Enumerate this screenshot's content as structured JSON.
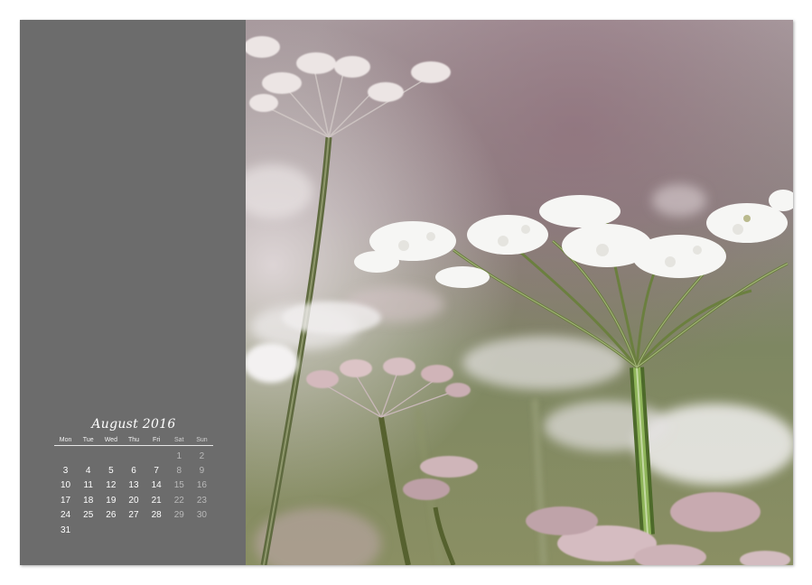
{
  "calendar": {
    "month_title": "August 2016",
    "weekdays": [
      "Mon",
      "Tue",
      "Wed",
      "Thu",
      "Fri",
      "Sat",
      "Sun"
    ],
    "weeks": [
      [
        "",
        "",
        "",
        "",
        "",
        "1",
        "2"
      ],
      [
        "3",
        "4",
        "5",
        "6",
        "7",
        "8",
        "9"
      ],
      [
        "10",
        "11",
        "12",
        "13",
        "14",
        "15",
        "16"
      ],
      [
        "17",
        "18",
        "19",
        "20",
        "21",
        "22",
        "23"
      ],
      [
        "24",
        "25",
        "26",
        "27",
        "28",
        "29",
        "30"
      ],
      [
        "31",
        "",
        "",
        "",
        "",
        "",
        ""
      ]
    ]
  },
  "colors": {
    "panel": "#6c6c6c",
    "text": "#ffffff",
    "weekend": "#b9b9b9",
    "photo_green": "#7f8a5c",
    "photo_pink": "#9c7f86",
    "flower": "#f4f4f2"
  },
  "photo": {
    "subject": "cow parsley umbels"
  }
}
